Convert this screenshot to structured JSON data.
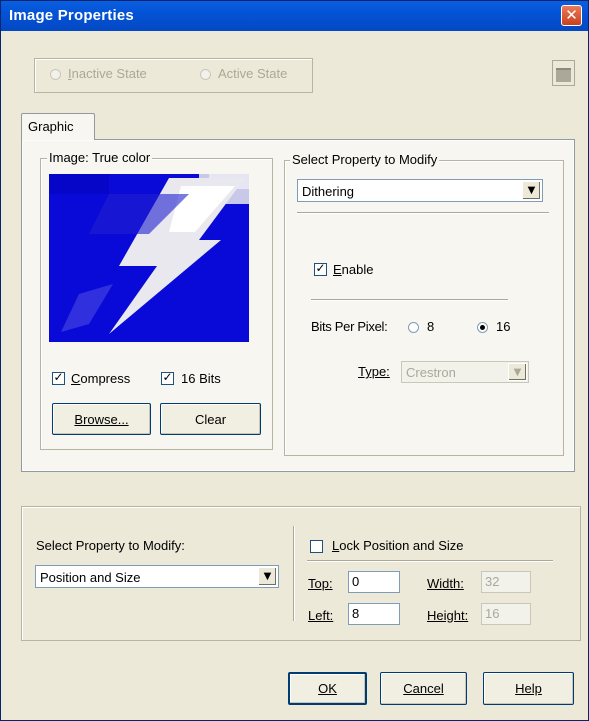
{
  "window": {
    "title": "Image Properties"
  },
  "state_bar": {
    "inactive_state": "Inactive State",
    "active_state": "Active State"
  },
  "tabs": [
    {
      "label": "Graphic"
    }
  ],
  "image_group": {
    "legend": "Image: True color",
    "compress_label": "Compress",
    "compress_checked": true,
    "bits16_label": "16 Bits",
    "bits16_checked": true,
    "browse_label": "Browse...",
    "clear_label": "Clear"
  },
  "property_group": {
    "legend": "Select Property to Modify",
    "selected": "Dithering",
    "enable_label": "Enable",
    "enable_checked": true,
    "bits_per_pixel_label": "Bits Per Pixel:",
    "bpp_options": [
      "8",
      "16"
    ],
    "bpp_selected": "16",
    "type_label": "Type:",
    "type_value": "Crestron"
  },
  "position_section": {
    "select_label": "Select Property to Modify:",
    "selected": "Position and Size",
    "lock_label": "Lock Position and Size",
    "lock_checked": false,
    "top_label": "Top:",
    "top_value": "0",
    "left_label": "Left:",
    "left_value": "8",
    "width_label": "Width:",
    "width_value": "32",
    "height_label": "Height:",
    "height_value": "16"
  },
  "buttons": {
    "ok": "OK",
    "cancel": "Cancel",
    "help": "Help"
  },
  "colors": {
    "title_bar": "#0453d6",
    "dialog_bg": "#ece9d8",
    "image_bg": "#0a0ad8",
    "bolt": "#f2f2f2"
  }
}
